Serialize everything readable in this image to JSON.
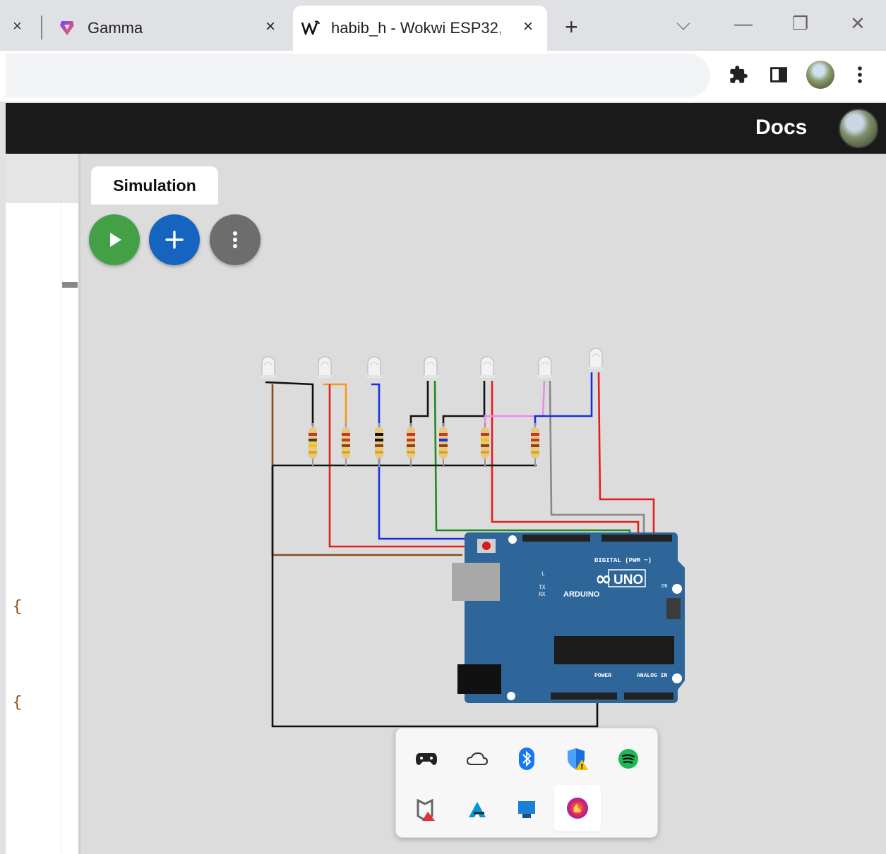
{
  "browser": {
    "tabs": [
      {
        "title": "Gamma",
        "icon": "gamma-icon"
      },
      {
        "title": "habib_h - Wokwi ESP32, ",
        "icon": "wokwi-icon",
        "active": true
      }
    ],
    "tab_close_glyph": "×",
    "new_tab_glyph": "+",
    "window_controls": {
      "dropdown": "⌵",
      "minimize": "—",
      "restore": "❐",
      "close": "✕"
    },
    "toolbar_icons": [
      "extensions-icon",
      "side-panel-icon",
      "profile-avatar",
      "menu-icon"
    ]
  },
  "wokwi": {
    "header": {
      "docs_label": "Docs"
    },
    "simulation_tab": "Simulation",
    "fabs": [
      "play-icon",
      "add-icon",
      "more-icon"
    ],
    "editor_braces": [
      "{",
      "{"
    ],
    "board": {
      "name": "UNO",
      "brand": "ARDUINO",
      "digital_label": "DIGITAL (PWM ~)",
      "power_label": "POWER",
      "analog_label": "ANALOG IN",
      "on_label": "ON",
      "tx_label": "TX",
      "rx_label": "RX",
      "l_label": "L"
    },
    "led_count": 7,
    "resistor_count": 7
  },
  "tray": {
    "items": [
      "gamepad-icon",
      "onedrive-icon",
      "bluetooth-icon",
      "defender-warning-icon",
      "spotify-icon",
      "mcafee-icon",
      "autodesk-icon",
      "device-icon",
      "firefox-dev-icon"
    ],
    "selected": "firefox-dev-icon"
  },
  "colors": {
    "sim_bg": "#dcdcdc",
    "header_bg": "#1a1a1a",
    "board": "#2e6699",
    "play": "#43a047",
    "add": "#1565c0",
    "more": "#6d6d6d"
  }
}
